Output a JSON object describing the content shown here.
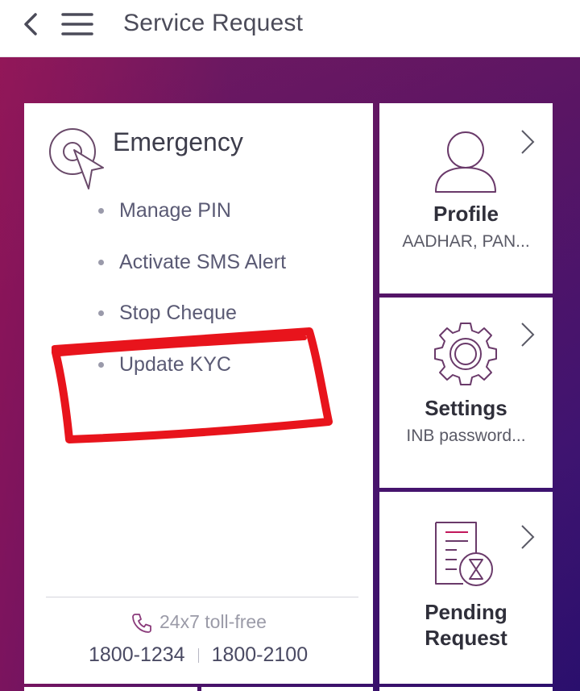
{
  "header": {
    "title": "Service Request",
    "back_icon": "chevron-left-icon",
    "menu_icon": "hamburger-icon"
  },
  "emergency": {
    "title": "Emergency",
    "icon": "target-cursor-icon",
    "items": [
      {
        "label": "Manage PIN"
      },
      {
        "label": "Activate SMS Alert"
      },
      {
        "label": "Stop Cheque"
      },
      {
        "label": "Update KYC"
      }
    ],
    "tollfree_label": "24x7 toll-free",
    "phone_icon": "phone-icon",
    "phone_numbers": [
      "1800-1234",
      "1800-2100"
    ]
  },
  "cards": [
    {
      "title": "Profile",
      "subtitle": "AADHAR, PAN...",
      "icon": "user-icon"
    },
    {
      "title": "Settings",
      "subtitle": "INB password...",
      "icon": "gear-icon"
    },
    {
      "title_line1": "Pending",
      "title_line2": "Request",
      "icon": "document-hourglass-icon"
    }
  ],
  "colors": {
    "gradient_start": "#b0154f",
    "gradient_end": "#2a0f6d",
    "annotation_red": "#e8141c",
    "icon_accent": "#7a2a6e"
  }
}
